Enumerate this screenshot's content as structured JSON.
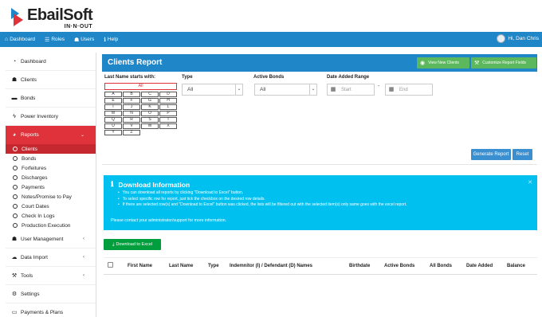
{
  "brand": {
    "name": "EbailSoft",
    "tagline": "IN·N·OUT"
  },
  "topnav": {
    "items": [
      {
        "icon": "home-icon",
        "label": "Dashboard"
      },
      {
        "icon": "list-icon",
        "label": "Roles"
      },
      {
        "icon": "users-icon",
        "label": "Users"
      },
      {
        "icon": "info-icon",
        "label": "Help"
      }
    ],
    "user_label": "Hi, Dan Chris"
  },
  "sidebar": {
    "items": [
      {
        "icon": "dashboard-icon",
        "label": "Dashboard"
      },
      {
        "icon": "users-icon",
        "label": "Clients"
      },
      {
        "icon": "folder-icon",
        "label": "Bonds"
      },
      {
        "icon": "bolt-icon",
        "label": "Power Inventory"
      },
      {
        "icon": "pie-chart-icon",
        "label": "Reports",
        "active": true
      }
    ],
    "report_subitems": [
      "Clients",
      "Bonds",
      "Forfeitures",
      "Discharges",
      "Payments",
      "Notes/Promise to Pay",
      "Court Dates",
      "Check In Logs",
      "Production Execution"
    ],
    "bottom_items": [
      {
        "icon": "users-icon",
        "label": "User Management"
      },
      {
        "icon": "cloud-upload-icon",
        "label": "Data Import"
      },
      {
        "icon": "wrench-icon",
        "label": "Tools"
      },
      {
        "icon": "gear-icon",
        "label": "Settings"
      },
      {
        "icon": "credit-card-icon",
        "label": "Payments & Plans"
      }
    ]
  },
  "header": {
    "title": "Clients Report",
    "view_new_clients": "View New Clients",
    "customize_fields": "Customize Report Fields"
  },
  "filters": {
    "last_name_label": "Last Name starts with:",
    "all_label": "All",
    "letters": [
      "A",
      "B",
      "C",
      "D",
      "E",
      "F",
      "G",
      "H",
      "I",
      "J",
      "K",
      "L",
      "M",
      "N",
      "O",
      "P",
      "Q",
      "R",
      "S",
      "T",
      "U",
      "V",
      "W",
      "X",
      "Y",
      "Z"
    ],
    "type_label": "Type",
    "type_value": "All",
    "active_bonds_label": "Active Bonds",
    "active_bonds_value": "All",
    "date_added_label": "Date Added Range",
    "start_placeholder": "Start",
    "end_placeholder": "End"
  },
  "actions": {
    "generate": "Generate Report",
    "reset": "Reset"
  },
  "info": {
    "title": "Download Information",
    "bullets": [
      "You can download all reports by clicking \"Download to Excel\" button.",
      "To select specific row for report, just tick the checkbox on the desired row details.",
      "If there are selected row(s) and \"Download to Excel\" button was clicked, the lists will be filtered out with the selected item(s) only same goes with the excel report."
    ],
    "contact": "Please contact your administrator/support for more information."
  },
  "download_label": "Download to Excel",
  "table": {
    "columns": [
      "First Name",
      "Last Name",
      "Type",
      "Indemnitor (I) / Defendant (D) Names",
      "Birthdate",
      "Active Bonds",
      "All Bonds",
      "Date Added",
      "Balance"
    ]
  },
  "colors": {
    "primary": "#1f86c8",
    "danger": "#e0323a",
    "info": "#00c0ef",
    "success": "#5cb85c",
    "excel": "#009e3d"
  }
}
